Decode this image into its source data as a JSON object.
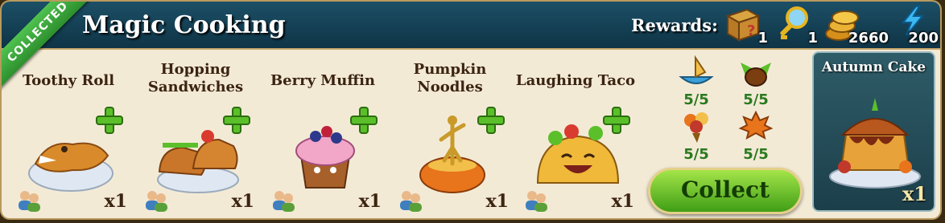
{
  "header": {
    "title": "Magic Cooking",
    "ribbon": "COLLECTED",
    "rewards_label": "Rewards:",
    "rewards": [
      {
        "icon": "mystery-box-icon",
        "count": "1"
      },
      {
        "icon": "magnifier-key-icon",
        "count": "1"
      },
      {
        "icon": "coins-icon",
        "count": "2660"
      },
      {
        "icon": "energy-bolt-icon",
        "count": "200"
      }
    ]
  },
  "recipes": [
    {
      "name": "Toothy Roll",
      "qty": "x1",
      "icon": "crocodile-bread-icon"
    },
    {
      "name": "Hopping Sandwiches",
      "qty": "x1",
      "icon": "shoe-sandwich-icon"
    },
    {
      "name": "Berry Muffin",
      "qty": "x1",
      "icon": "berry-muffin-icon"
    },
    {
      "name": "Pumpkin Noodles",
      "qty": "x1",
      "icon": "pumpkin-noodles-icon"
    },
    {
      "name": "Laughing Taco",
      "qty": "x1",
      "icon": "laughing-taco-icon"
    }
  ],
  "ingredients": [
    {
      "icon": "autumn-leaf-boat-icon",
      "progress": "5/5"
    },
    {
      "icon": "chestnut-icon",
      "progress": "5/5"
    },
    {
      "icon": "autumn-bouquet-icon",
      "progress": "5/5"
    },
    {
      "icon": "maple-leaf-icon",
      "progress": "5/5"
    }
  ],
  "collect_label": "Collect",
  "final_reward": {
    "name": "Autumn Cake",
    "qty": "x1",
    "icon": "autumn-cake-icon"
  },
  "colors": {
    "header": "#15445a",
    "panel": "#f3ead6",
    "accent_green": "#4fb52a",
    "progress_green": "#2a7a1f"
  }
}
